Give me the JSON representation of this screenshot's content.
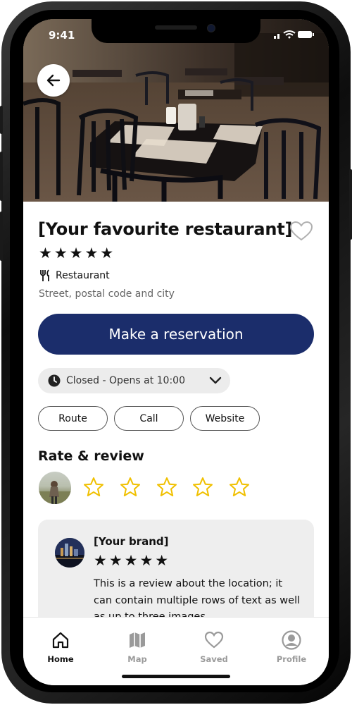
{
  "status_bar": {
    "time": "9:41"
  },
  "place": {
    "title": "[Your favourite restaurant]",
    "rating_stars": "★★★★★",
    "category": "Restaurant",
    "address": "Street, postal code and city"
  },
  "actions": {
    "reserve_label": "Make a reservation",
    "hours_text": "Closed - Opens at 10:00",
    "quick_links": [
      "Route",
      "Call",
      "Website"
    ]
  },
  "rate_review": {
    "title": "Rate & review",
    "empty_stars": 5
  },
  "review": {
    "author": "[Your brand]",
    "stars": "★★★★★",
    "text": "This is a review about the location; it can contain multiple rows of text as well as up to three images"
  },
  "bottom_nav": {
    "items": [
      {
        "label": "Home",
        "icon": "home-icon",
        "active": true
      },
      {
        "label": "Map",
        "icon": "map-icon",
        "active": false
      },
      {
        "label": "Saved",
        "icon": "heart-icon",
        "active": false
      },
      {
        "label": "Profile",
        "icon": "profile-icon",
        "active": false
      }
    ]
  },
  "colors": {
    "primary": "#1b2d6b",
    "star_outline": "#f0c000",
    "nav_active": "#111111",
    "nav_inactive": "#9a9a9a"
  }
}
